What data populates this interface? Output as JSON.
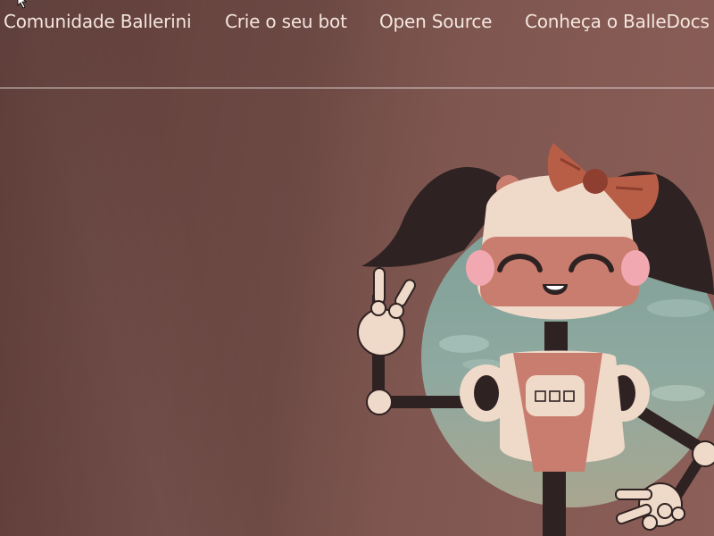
{
  "nav": {
    "items": [
      {
        "label": "Comunidade Ballerini"
      },
      {
        "label": "Crie o seu bot"
      },
      {
        "label": "Open Source"
      },
      {
        "label": "Conheça o BalleDocs"
      }
    ]
  },
  "hero": {
    "illustration_icon": "robot-girl-illustration"
  },
  "colors": {
    "background": "#6f4a45",
    "nav_text": "#f4e6df",
    "robot_face": "#c97d6e",
    "robot_shell": "#efd9c8",
    "hair": "#2f2222",
    "bow": "#b85e47",
    "circle_bg": "#8aa39a"
  }
}
